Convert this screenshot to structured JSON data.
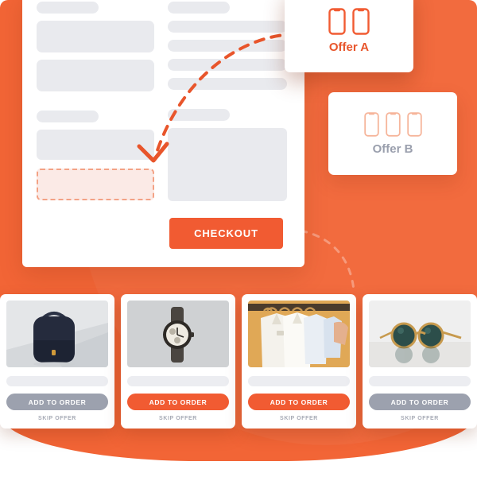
{
  "theme": {
    "brand_orange": "#F26536",
    "button_orange": "#F15B32",
    "muted_gray": "#9CA1AE",
    "skeleton_gray": "#E9EAEE",
    "highlight_fill": "#FBEAE6",
    "highlight_border": "#F3A285"
  },
  "form": {
    "checkout_label": "CHECKOUT",
    "highlight_field_name": "offer-highlight-field"
  },
  "offers": [
    {
      "id": "offer-a",
      "label": "Offer A",
      "phone_count": 2,
      "icon": "phone-icon",
      "label_color": "#E8552B"
    },
    {
      "id": "offer-b",
      "label": "Offer B",
      "phone_count": 3,
      "icon": "phone-icon",
      "label_color": "#9A9FAD"
    }
  ],
  "products": [
    {
      "id": "product-backpack",
      "image_name": "backpack-photo",
      "add_label": "ADD TO ORDER",
      "skip_label": "SKIP OFFER",
      "button_style": "muted"
    },
    {
      "id": "product-watch",
      "image_name": "watch-photo",
      "add_label": "ADD TO ORDER",
      "skip_label": "SKIP OFFER",
      "button_style": "accent"
    },
    {
      "id": "product-shirts",
      "image_name": "shirts-on-rack-photo",
      "add_label": "ADD TO ORDER",
      "skip_label": "SKIP OFFER",
      "button_style": "accent"
    },
    {
      "id": "product-sunglasses",
      "image_name": "sunglasses-photo",
      "add_label": "ADD TO ORDER",
      "skip_label": "SKIP OFFER",
      "button_style": "muted"
    }
  ],
  "annotations": {
    "arrow_to_field": "dashed-curved-arrow",
    "arrow_to_products": "dashed-curve-checkout-to-products"
  }
}
